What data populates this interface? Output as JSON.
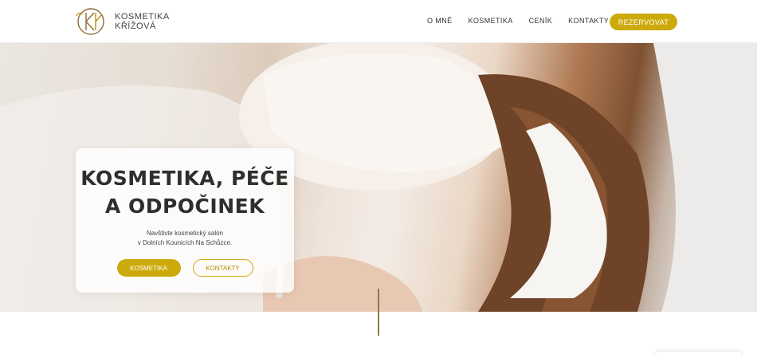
{
  "brand": {
    "line1": "KOSMETIKA",
    "line2": "KŘÍŽOVÁ",
    "accent_color": "#cdaa0c"
  },
  "nav": {
    "items": [
      {
        "label": "O MNĚ"
      },
      {
        "label": "KOSMETIKA"
      },
      {
        "label": "CENÍK"
      },
      {
        "label": "KONTAKTY"
      }
    ],
    "reserve_label": "REZERVOVAT"
  },
  "hero": {
    "title_line1": "KOSMETIKA, PÉČE",
    "title_line2": "A ODPOČINEK",
    "subtitle_line1": "Navštivte kosmetický salón",
    "subtitle_line2": "v Dolních Kounicích Na Schůzce.",
    "primary_button": "KOSMETIKA",
    "secondary_button": "KONTAKTY"
  }
}
